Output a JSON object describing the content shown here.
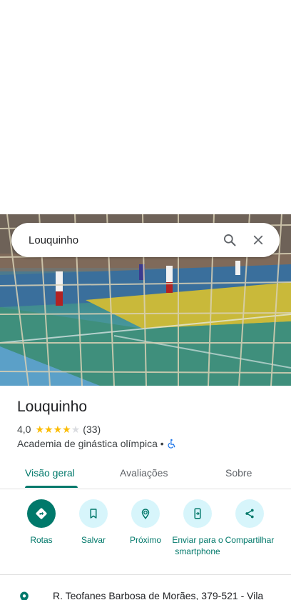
{
  "search": {
    "query": "Louquinho"
  },
  "place": {
    "name": "Louquinho",
    "rating": "4,0",
    "rating_value": 4,
    "review_count": "(33)",
    "category": "Academia de ginástica olímpica •",
    "address": "R. Teofanes Barbosa de Morães, 379-521 - Vila"
  },
  "tabs": [
    {
      "label": "Visão geral"
    },
    {
      "label": "Avaliações"
    },
    {
      "label": "Sobre"
    }
  ],
  "actions": [
    {
      "label": "Rotas",
      "icon": "directions-icon"
    },
    {
      "label": "Salvar",
      "icon": "bookmark-icon"
    },
    {
      "label": "Próximo",
      "icon": "nearby-icon"
    },
    {
      "label": "Enviar para o smartphone",
      "icon": "send-to-phone-icon"
    },
    {
      "label": "Compartilhar",
      "icon": "share-icon"
    }
  ],
  "colors": {
    "accent": "#00786a",
    "action_bg": "#d7f5fb",
    "star": "#fbbc04"
  }
}
